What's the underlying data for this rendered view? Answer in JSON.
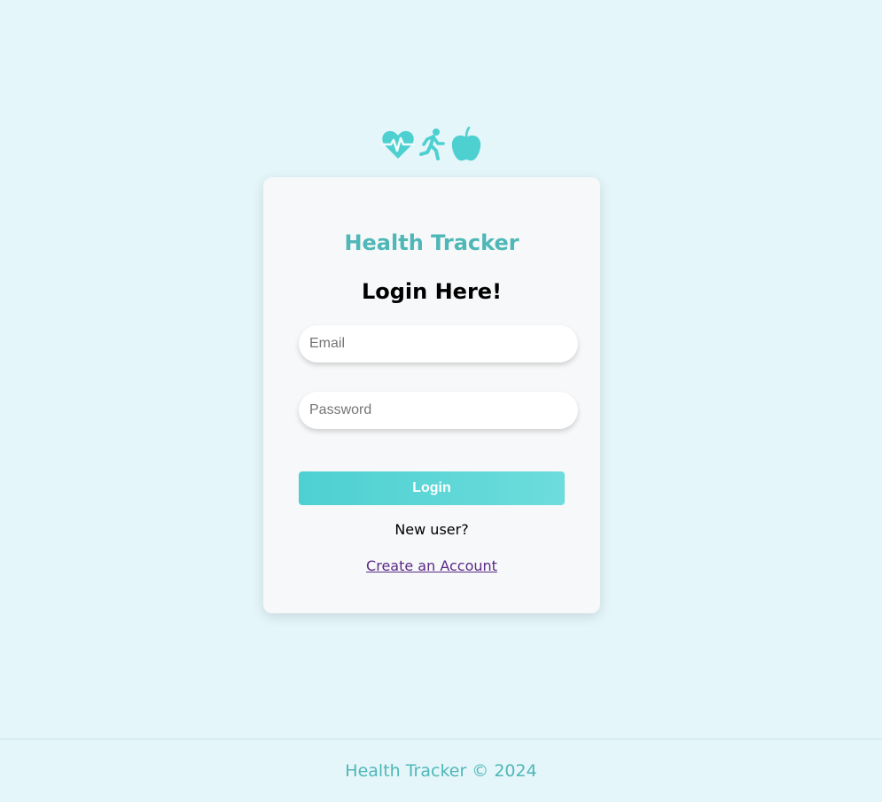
{
  "header": {
    "icons": [
      "heartbeat-icon",
      "running-icon",
      "apple-icon"
    ],
    "icon_color": "#4ed0d1"
  },
  "login_card": {
    "brand_title": "Health Tracker",
    "heading": "Login Here!",
    "email_placeholder": "Email",
    "password_placeholder": "Password",
    "login_button_label": "Login",
    "new_user_text": "New user?",
    "create_account_link": "Create an Account"
  },
  "footer": {
    "text": "Health Tracker © 2024"
  },
  "colors": {
    "background": "#e4f6fa",
    "card_background": "#f6f8f9",
    "brand": "#4fb7b7",
    "button_gradient_start": "#4ed0d1",
    "button_gradient_end": "#6ddcdc",
    "link": "#5b2a86"
  }
}
